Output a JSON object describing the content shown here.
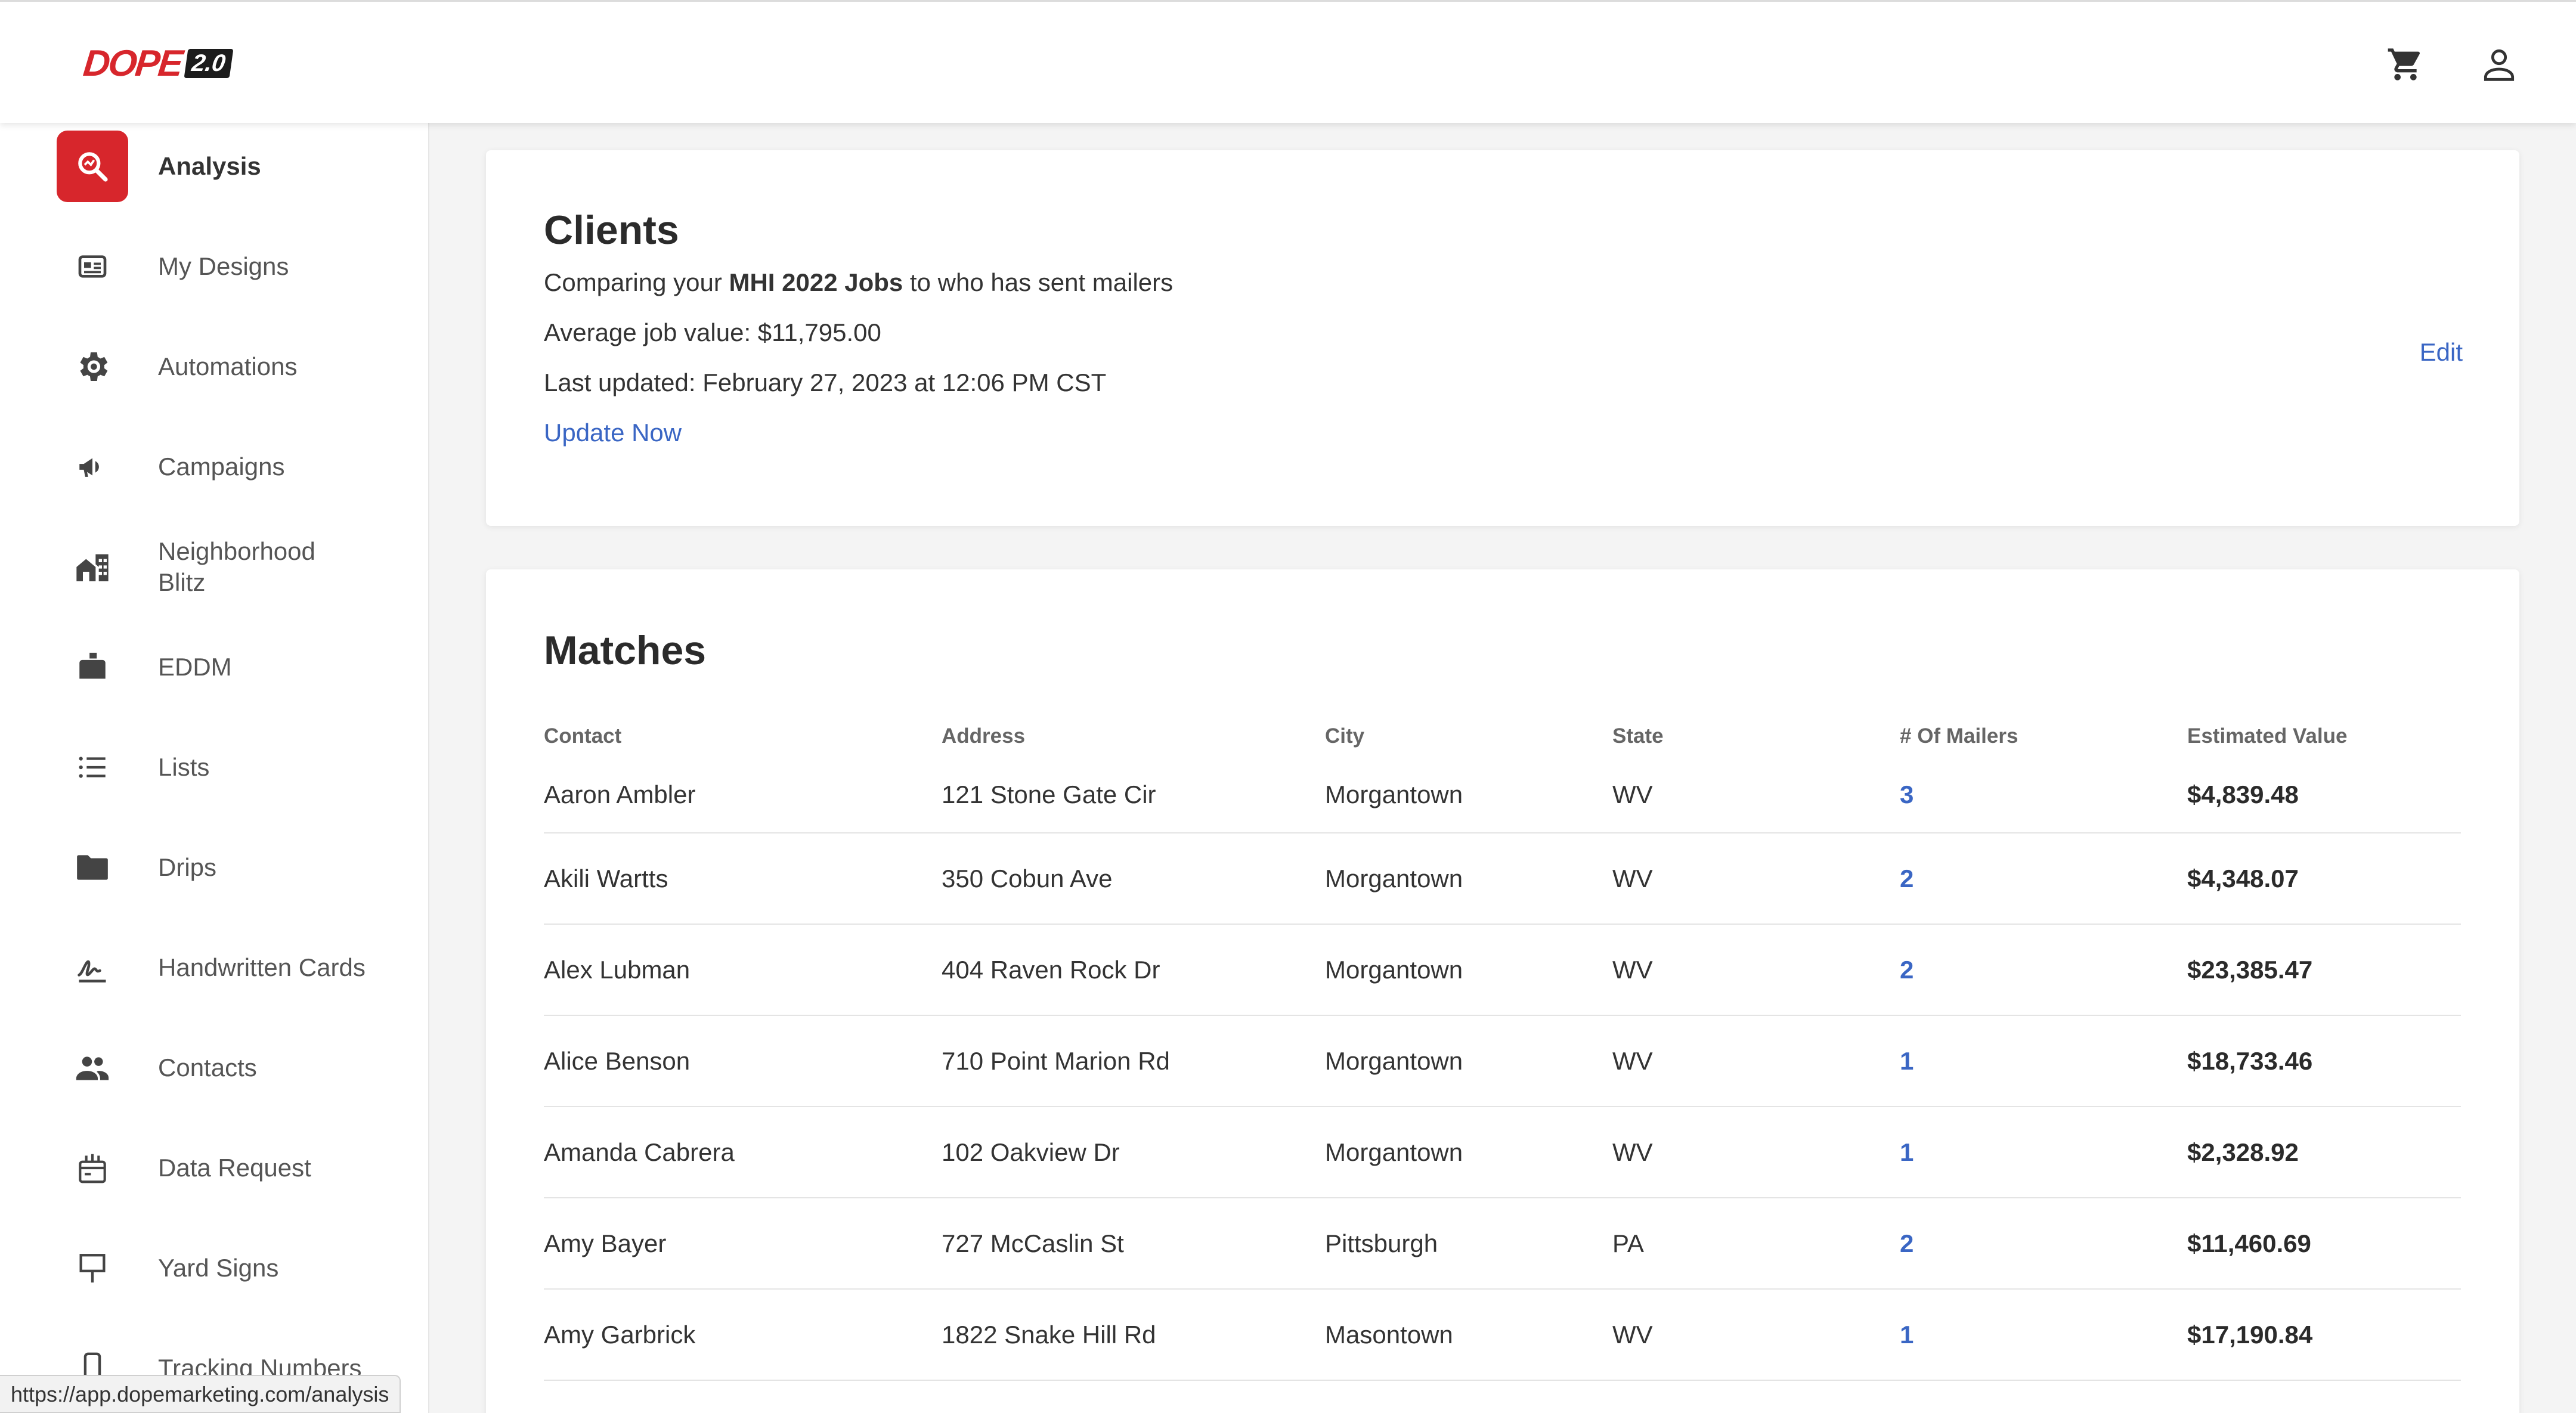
{
  "header": {
    "logo_text": "DOPE",
    "logo_badge": "2.0",
    "icons": [
      "shopping-cart-icon",
      "account-icon"
    ]
  },
  "sidebar": {
    "items": [
      {
        "label": "Analysis",
        "icon": "magnifier-icon",
        "active": true
      },
      {
        "label": "My Designs",
        "icon": "design-card-icon"
      },
      {
        "label": "Automations",
        "icon": "gear-icon"
      },
      {
        "label": "Campaigns",
        "icon": "megaphone-icon"
      },
      {
        "label": "Neighborhood Blitz",
        "icon": "neighborhood-icon"
      },
      {
        "label": "EDDM",
        "icon": "mailbox-icon"
      },
      {
        "label": "Lists",
        "icon": "list-icon"
      },
      {
        "label": "Drips",
        "icon": "folder-icon"
      },
      {
        "label": "Handwritten Cards",
        "icon": "signature-icon"
      },
      {
        "label": "Contacts",
        "icon": "people-icon"
      },
      {
        "label": "Data Request",
        "icon": "data-request-icon"
      },
      {
        "label": "Yard Signs",
        "icon": "yard-sign-icon"
      },
      {
        "label": "Tracking Numbers",
        "icon": "phone-icon"
      }
    ]
  },
  "clients": {
    "title": "Clients",
    "comparing_prefix": "Comparing your ",
    "comparing_bold": "MHI 2022 Jobs",
    "comparing_suffix": " to who has sent mailers",
    "average_job_value": "Average job value: $11,795.00",
    "last_updated": "Last updated: February 27, 2023 at 12:06 PM CST",
    "update_now": "Update Now",
    "edit": "Edit"
  },
  "matches": {
    "title": "Matches",
    "columns": [
      "Contact",
      "Address",
      "City",
      "State",
      "# Of Mailers",
      "Estimated Value"
    ],
    "rows": [
      [
        "Aaron Ambler",
        "121 Stone Gate Cir",
        "Morgantown",
        "WV",
        "3",
        "$4,839.48"
      ],
      [
        "Akili Wartts",
        "350 Cobun Ave",
        "Morgantown",
        "WV",
        "2",
        "$4,348.07"
      ],
      [
        "Alex Lubman",
        "404 Raven Rock Dr",
        "Morgantown",
        "WV",
        "2",
        "$23,385.47"
      ],
      [
        "Alice Benson",
        "710 Point Marion Rd",
        "Morgantown",
        "WV",
        "1",
        "$18,733.46"
      ],
      [
        "Amanda Cabrera",
        "102 Oakview Dr",
        "Morgantown",
        "WV",
        "1",
        "$2,328.92"
      ],
      [
        "Amy Bayer",
        "727 McCaslin St",
        "Pittsburgh",
        "PA",
        "2",
        "$11,460.69"
      ],
      [
        "Amy Garbrick",
        "1822 Snake Hill Rd",
        "Masontown",
        "WV",
        "1",
        "$17,190.84"
      ]
    ]
  },
  "status_bar": {
    "url": "https://app.dopemarketing.com/analysis"
  },
  "colors": {
    "brand_red": "#d7262c",
    "link_blue": "#3a66c4"
  }
}
